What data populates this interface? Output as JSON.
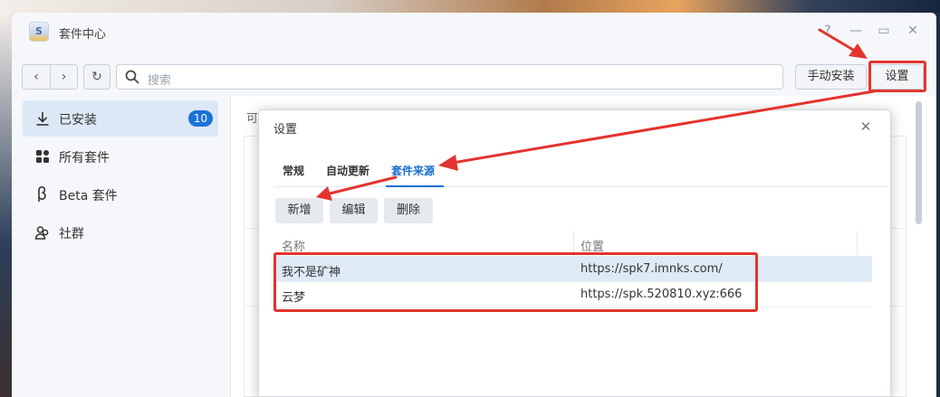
{
  "window": {
    "title": "套件中心",
    "app_icon_glyph": "S",
    "help_glyph": "?",
    "minimize_glyph": "—",
    "maximize_glyph": "▭",
    "close_glyph": "✕"
  },
  "toolbar": {
    "back_glyph": "‹",
    "forward_glyph": "›",
    "refresh_glyph": "↻",
    "search_placeholder": "搜索",
    "manual_install_label": "手动安装",
    "settings_label": "设置"
  },
  "sidebar": {
    "items": [
      {
        "label": "已安装",
        "icon": "download-icon",
        "badge": "10"
      },
      {
        "label": "所有套件",
        "icon": "grid-icon"
      },
      {
        "label": "Beta 套件",
        "icon": "beta-icon"
      },
      {
        "label": "社群",
        "icon": "community-icon"
      }
    ]
  },
  "content": {
    "peek_text": "可"
  },
  "dialog": {
    "title": "设置",
    "close_glyph": "✕",
    "tabs": [
      {
        "label": "常规"
      },
      {
        "label": "自动更新"
      },
      {
        "label": "套件来源",
        "active": true
      }
    ],
    "actions": {
      "add_label": "新增",
      "edit_label": "编辑",
      "delete_label": "删除"
    },
    "grid": {
      "columns": [
        "名称",
        "位置"
      ],
      "rows": [
        {
          "name": "我不是矿神",
          "location": "https://spk7.imnks.com/"
        },
        {
          "name": "云梦",
          "location": "https://spk.520810.xyz:666"
        }
      ]
    }
  },
  "colors": {
    "accent": "#1a6fd0",
    "badge": "#1a73d8",
    "annotation_red": "#e3342f",
    "selected_row": "#dfeaf7",
    "sidebar_active": "#dce8f6"
  }
}
